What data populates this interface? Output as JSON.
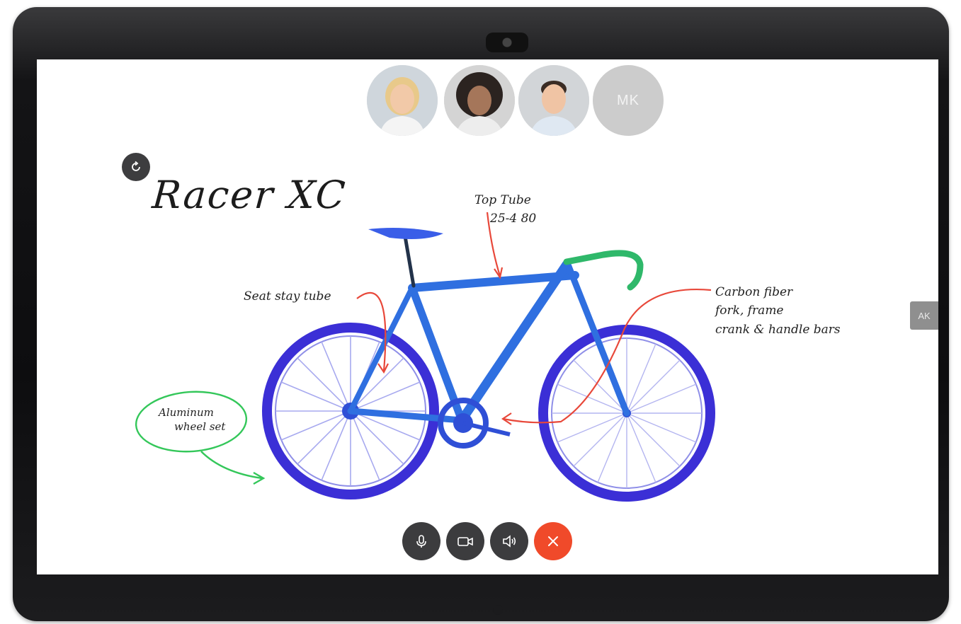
{
  "meeting": {
    "participants": [
      {
        "kind": "photo",
        "name": "participant-1"
      },
      {
        "kind": "photo",
        "name": "participant-2"
      },
      {
        "kind": "photo",
        "name": "participant-3"
      },
      {
        "kind": "initials",
        "initials": "MK"
      }
    ],
    "side_tab_label": "AK"
  },
  "whiteboard": {
    "title": "Racer XC",
    "annotations": {
      "top_tube": [
        "Top Tube",
        "25-4 80"
      ],
      "seat_stay": [
        "Seat stay tube"
      ],
      "carbon": [
        "Carbon fiber",
        "fork, frame",
        "crank & handle bars"
      ],
      "wheel": [
        "Aluminum",
        "wheel set"
      ]
    },
    "colors": {
      "frame": "#2f6fe0",
      "wheel": "#3b2fd6",
      "saddle": "#3a5ee8",
      "bars": "#2fb86a",
      "red_ink": "#e8483a",
      "green_ink": "#34c75a"
    }
  },
  "controls": [
    {
      "name": "mute-button",
      "icon": "microphone-icon"
    },
    {
      "name": "video-button",
      "icon": "camera-icon"
    },
    {
      "name": "speaker-button",
      "icon": "speaker-icon"
    },
    {
      "name": "end-call-button",
      "icon": "close-icon",
      "color": "#f04a2a"
    }
  ]
}
